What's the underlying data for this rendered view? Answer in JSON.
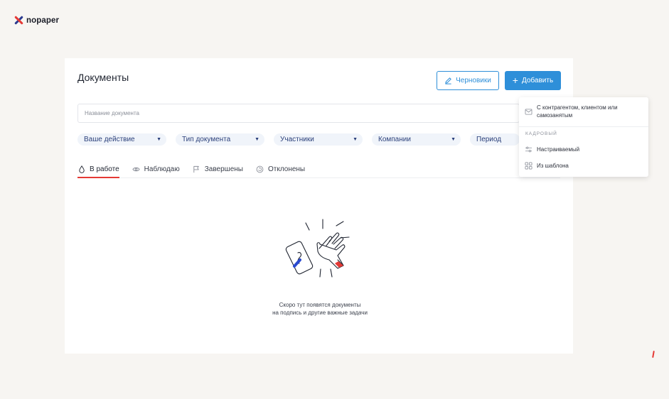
{
  "app": {
    "logo_text": "nopaper",
    "logo_icon": "x-mark-icon",
    "brand_colors": {
      "blue": "#2b3a8f",
      "red": "#e53935"
    }
  },
  "page": {
    "title": "Документы"
  },
  "toolbar": {
    "drafts_label": "Черновики",
    "drafts_icon": "pencil-icon",
    "add_label": "Добавить",
    "add_icon": "plus-icon"
  },
  "search": {
    "placeholder": "Название документа",
    "value": ""
  },
  "filters": [
    {
      "label": "Ваше действие"
    },
    {
      "label": "Тип документа"
    },
    {
      "label": "Участники"
    },
    {
      "label": "Компании"
    },
    {
      "label": "Период"
    }
  ],
  "tabs": [
    {
      "label": "В работе",
      "icon": "drop-icon",
      "active": true
    },
    {
      "label": "Наблюдаю",
      "icon": "eye-icon"
    },
    {
      "label": "Завершены",
      "icon": "flag-icon"
    },
    {
      "label": "Отклонены",
      "icon": "rotate-icon"
    }
  ],
  "empty_state": {
    "line1": "Скоро тут появятся документы",
    "line2": "на подпись и другие важные задачи"
  },
  "add_menu": {
    "item_counterparty": "С контрагентом, клиентом или самозанятым",
    "section_label": "КАДРОВЫЙ",
    "item_custom": "Настраиваемый",
    "item_template": "Из шаблона"
  },
  "colors": {
    "accent": "#2e8fd9",
    "active_tab_underline": "#e53935",
    "filter_bg": "#f0f4fa"
  }
}
